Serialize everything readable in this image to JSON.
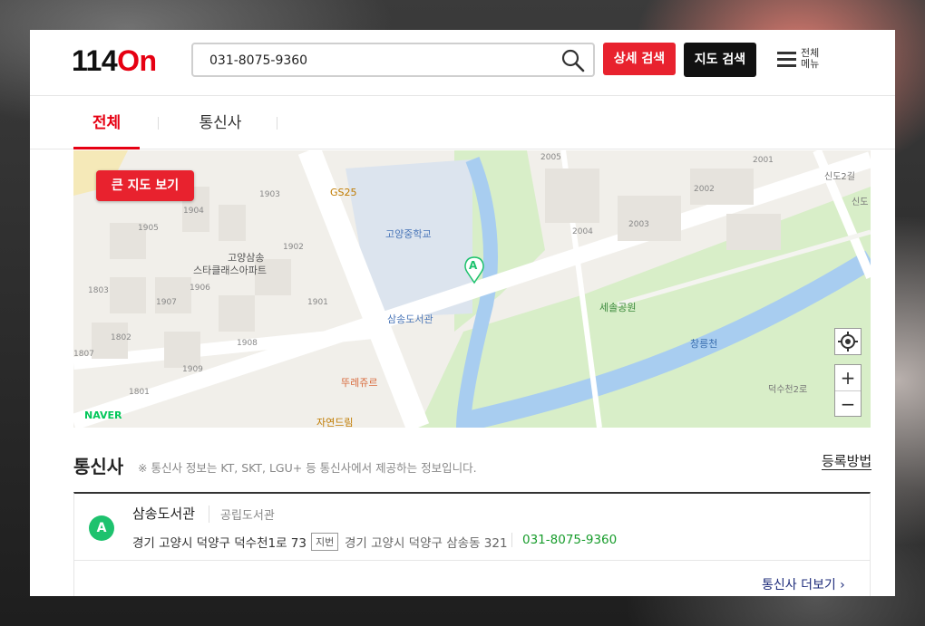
{
  "header": {
    "logo_num": "114",
    "logo_on": "On",
    "search_value": "031-8075-9360",
    "detail_search_label": "상세 검색",
    "map_search_label": "지도 검색",
    "menu_label": "전체\n메뉴"
  },
  "tabs": [
    {
      "label": "전체",
      "active": true
    },
    {
      "label": "통신사",
      "active": false
    }
  ],
  "map": {
    "big_map_label": "큰 지도 보기",
    "provider": "NAVER",
    "marker": "A",
    "labels": {
      "gs25": "GS25",
      "school": "고양중학교",
      "library": "삼송도서관",
      "apt_line1": "고양삼송",
      "apt_line2": "스타클래스아파트",
      "park": "세솔공원",
      "stream": "창릉천",
      "road1": "덕수천2로",
      "road2": "신도2길",
      "road3": "신도",
      "bakery": "뚜레쥬르",
      "shop": "자연드림",
      "b1903": "1903",
      "b1904": "1904",
      "b1905": "1905",
      "b1902": "1902",
      "b1803": "1803",
      "b1907": "1907",
      "b1906": "1906",
      "b1901": "1901",
      "b1802": "1802",
      "b1807": "1807",
      "b1908": "1908",
      "b1909": "1909",
      "b1801": "1801",
      "b2005": "2005",
      "b2004": "2004",
      "b2003": "2003",
      "b2002": "2002",
      "b2001": "2001"
    },
    "zoom_in": "+",
    "zoom_out": "−"
  },
  "section": {
    "title": "통신사",
    "note": "※ 통신사 정보는 KT, SKT, LGU+ 등 통신사에서 제공하는 정보입니다.",
    "register_link": "등록방법"
  },
  "result": {
    "marker": "A",
    "name": "삼송도서관",
    "category": "공립도서관",
    "address": "경기 고양시 덕양구 덕수천1로 73",
    "jibun_tag": "지번",
    "jibun_address": "경기 고양시 덕양구 삼송동 321",
    "phone": "031-8075-9360"
  },
  "more_link": "통신사 더보기 ›",
  "colors": {
    "brand_red": "#e60012",
    "button_red": "#e8222e",
    "phone_green": "#179c2b",
    "marker_green": "#1ec26e"
  }
}
